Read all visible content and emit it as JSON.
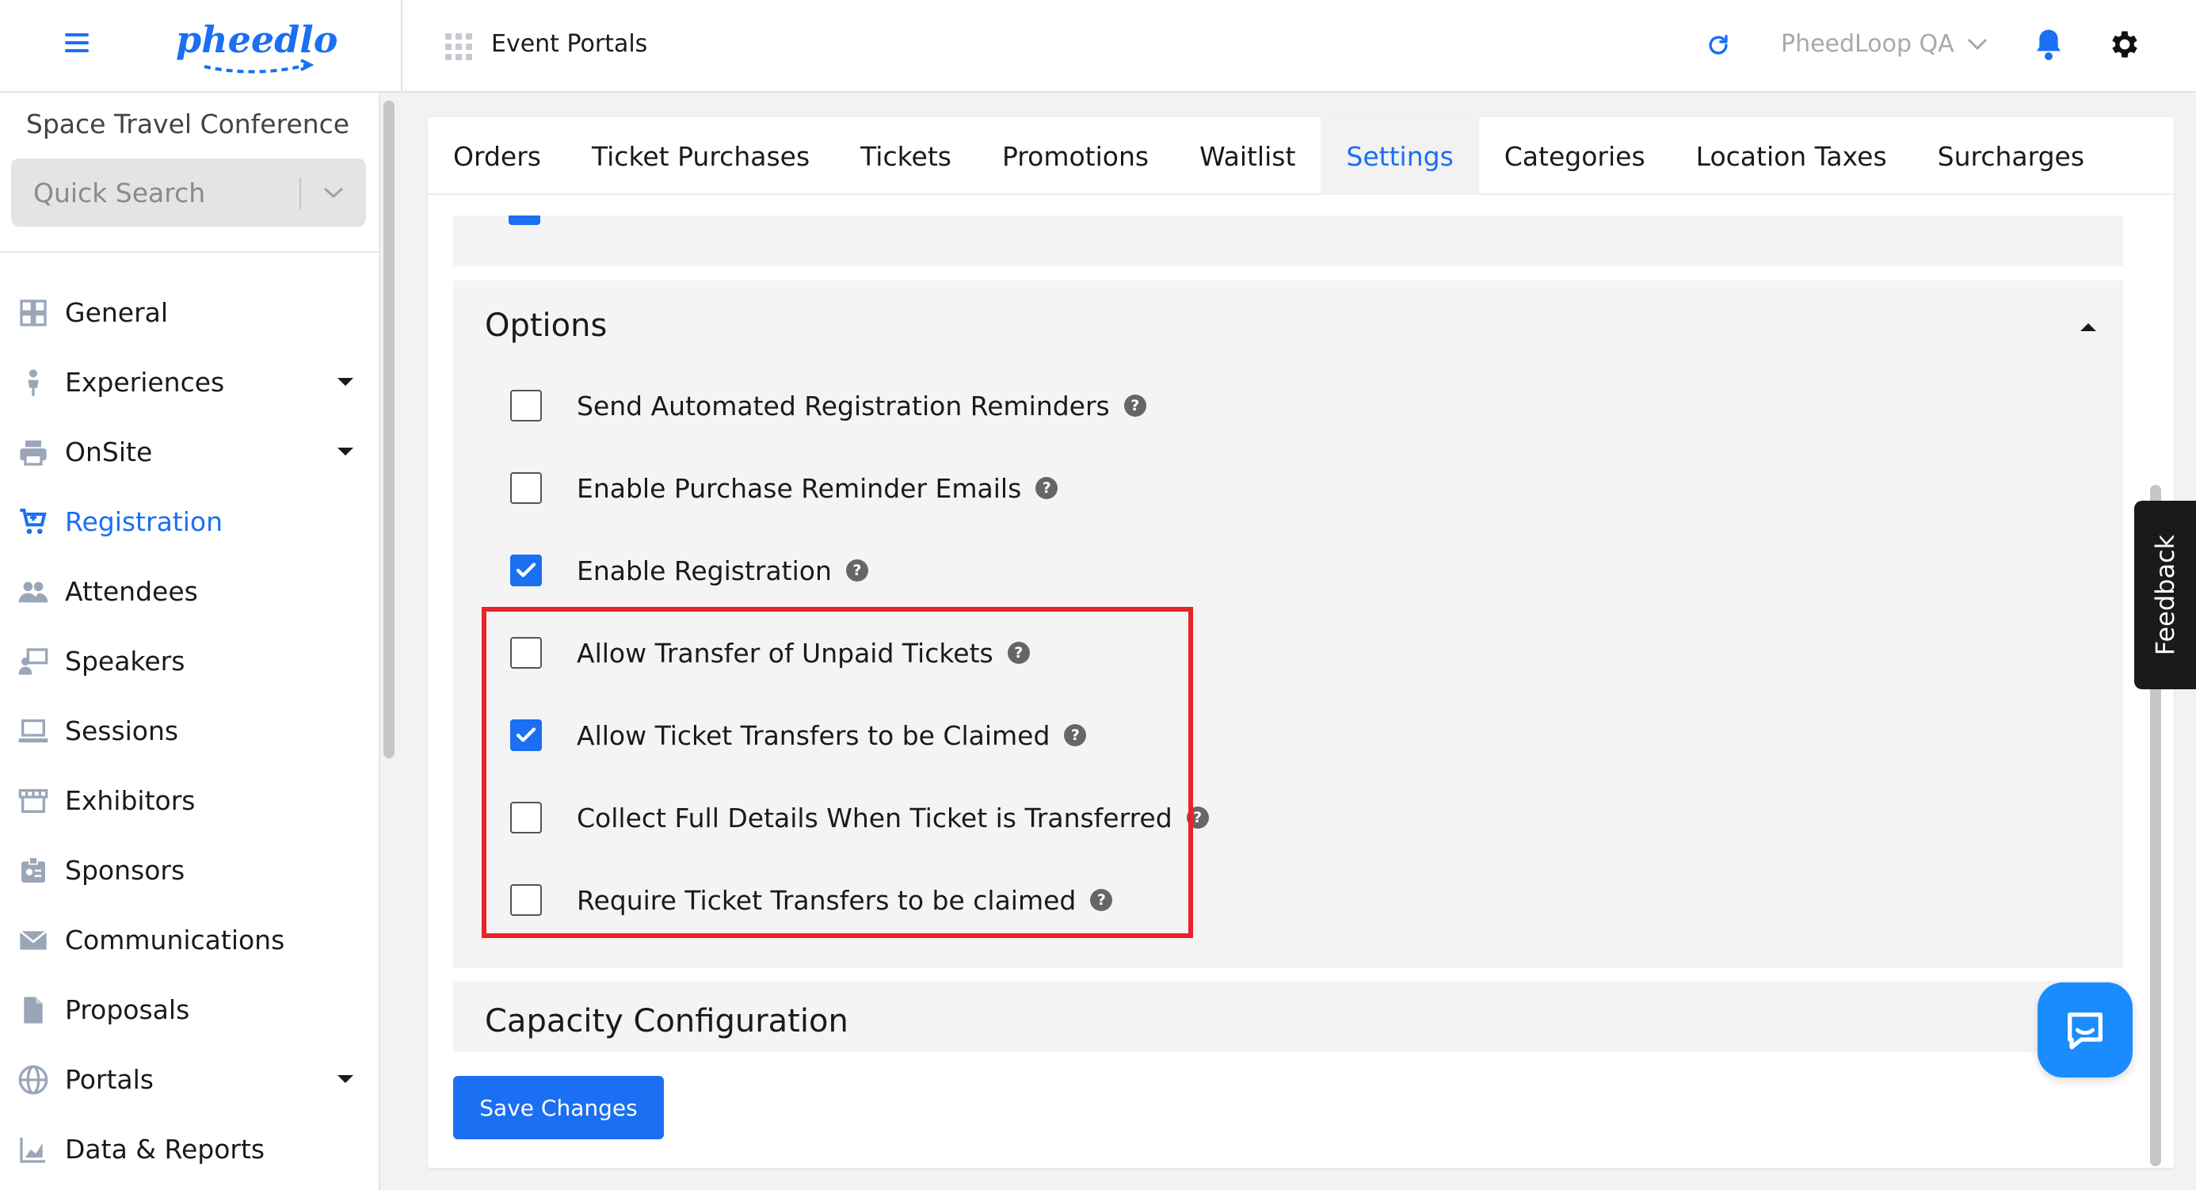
{
  "header": {
    "logo_text": "pheedloop",
    "portal_label": "Event Portals",
    "account_name": "PheedLoop QA"
  },
  "sidebar": {
    "event_name": "Space Travel Conference",
    "search_placeholder": "Quick Search",
    "items": [
      {
        "label": "General",
        "icon": "grid-icon"
      },
      {
        "label": "Experiences",
        "icon": "person-icon"
      },
      {
        "label": "OnSite",
        "icon": "printer-icon"
      },
      {
        "label": "Registration",
        "icon": "cart-icon"
      },
      {
        "label": "Attendees",
        "icon": "people-icon"
      },
      {
        "label": "Speakers",
        "icon": "presenter-icon"
      },
      {
        "label": "Sessions",
        "icon": "laptop-icon"
      },
      {
        "label": "Exhibitors",
        "icon": "store-icon"
      },
      {
        "label": "Sponsors",
        "icon": "badge-icon"
      },
      {
        "label": "Communications",
        "icon": "envelope-icon"
      },
      {
        "label": "Proposals",
        "icon": "document-icon"
      },
      {
        "label": "Portals",
        "icon": "globe-icon"
      },
      {
        "label": "Data & Reports",
        "icon": "chart-icon"
      }
    ],
    "active_item": "Registration"
  },
  "tabs": [
    "Orders",
    "Ticket Purchases",
    "Tickets",
    "Promotions",
    "Waitlist",
    "Settings",
    "Categories",
    "Location Taxes",
    "Surcharges"
  ],
  "active_tab": "Settings",
  "options": {
    "title": "Options",
    "items": [
      {
        "label": "Send Automated Registration Reminders",
        "checked": false
      },
      {
        "label": "Enable Purchase Reminder Emails",
        "checked": false
      },
      {
        "label": "Enable Registration",
        "checked": true
      },
      {
        "label": "Allow Transfer of Unpaid Tickets",
        "checked": false
      },
      {
        "label": "Allow Ticket Transfers to be Claimed",
        "checked": true
      },
      {
        "label": "Collect Full Details When Ticket is Transferred",
        "checked": false
      },
      {
        "label": "Require Ticket Transfers to be claimed",
        "checked": false
      }
    ],
    "help_glyph": "?"
  },
  "capacity": {
    "title": "Capacity Configuration"
  },
  "actions": {
    "save_label": "Save Changes"
  },
  "feedback_label": "Feedback",
  "colors": {
    "accent": "#1a6ff2",
    "highlight": "#e8232a",
    "chat": "#1a8cff"
  }
}
